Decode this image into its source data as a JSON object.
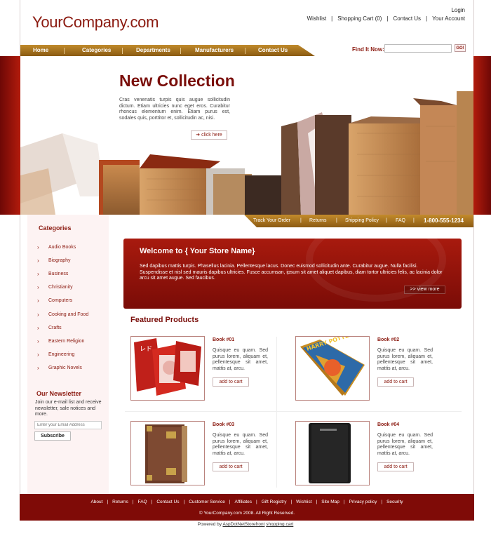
{
  "header": {
    "logo": "YourCompany.com",
    "login": "Login",
    "links": [
      "Wishlist",
      "Shopping Cart (0)",
      "Contact Us",
      "Your Account"
    ],
    "separator": "|"
  },
  "nav": {
    "items": [
      "Home",
      "Categories",
      "Departments",
      "Manufacturers",
      "Contact Us"
    ]
  },
  "search": {
    "label": "Find It Now:",
    "value": "",
    "go_label": "GO!"
  },
  "hero": {
    "title": "New Collection",
    "text": "Cras venenatis turpis quis augue sollicitudin dictum. Etiam ultricies nunc eget eros. Curabitur rhoncus elementum enim. Etiam purus est, sodales quis, porttitor et, sollicitudin ac, nisi.",
    "button_label": "click here",
    "button_icon": "arrow-right-icon"
  },
  "infobar": {
    "links": [
      "Track Your Order",
      "Returns",
      "Shipping Policy",
      "FAQ"
    ],
    "phone": "1-800-555-1234"
  },
  "sidebar": {
    "categories_title": "Categories",
    "categories": [
      "Audio Books",
      "Biography",
      "Business",
      "Christianity",
      "Computers",
      "Cooking and Food",
      "Crafts",
      "Eastern Religion",
      "Engineering",
      "Graphic Novels"
    ],
    "newsletter_title": "Our Newsletter",
    "newsletter_text": "Join our e-mail list and receive newsletter, sale notices and more.",
    "email_placeholder": "Enter your Email Address",
    "subscribe_label": "Subscribe"
  },
  "welcome": {
    "title": "Welcome to { Your Store Name}",
    "text": "Sed dapibus mattis turpis. Phasellus lacinia. Pellentesque lacus. Donec euismod sollicitudin ante. Curabitur augue. Nulla facilisi. Suspendisse et nisl sed mauris dapibus ultricies. Fusce accumsan, ipsum sit amet aliquet dapibus, diam tortor ultricies felis, ac lacinia dolor arcu sit amet augue. Sed faucibus.",
    "view_more_label": ">> view more"
  },
  "featured": {
    "title": "Featured Products",
    "products": [
      {
        "name": "Book #01",
        "desc": "Quisque eu quam. Sed purus lorem, aliquam et, pellentesque sit amet, mattis at, arcu.",
        "add_label": "add to cart"
      },
      {
        "name": "Book #02",
        "desc": "Quisque eu quam. Sed purus lorem, aliquam et, pellentesque sit amet, mattis at, arcu.",
        "add_label": "add to cart"
      },
      {
        "name": "Book #03",
        "desc": "Quisque eu quam. Sed purus lorem, aliquam et, pellentesque sit amet, mattis at, arcu.",
        "add_label": "add to cart"
      },
      {
        "name": "Book #04",
        "desc": "Quisque eu quam. Sed purus lorem, aliquam et, pellentesque sit amet, mattis at, arcu.",
        "add_label": "add to cart"
      }
    ]
  },
  "footer": {
    "links": [
      "About",
      "Returns",
      "FAQ",
      "Contact Us",
      "Customer Service",
      "Affiliates",
      "Gift Registry",
      "Wishlist",
      "Site Map",
      "Privacy policy",
      "Security"
    ],
    "copyright": "© YourCompany.com 2008. All Right Reserved.",
    "powered_prefix": "Powered by",
    "powered_link": "AspDotNetStorefront",
    "powered_suffix": "shopping cart"
  },
  "colors": {
    "brand_red": "#8b1a10",
    "gold": "#b07a22",
    "footer_bg": "#7f0b07"
  }
}
